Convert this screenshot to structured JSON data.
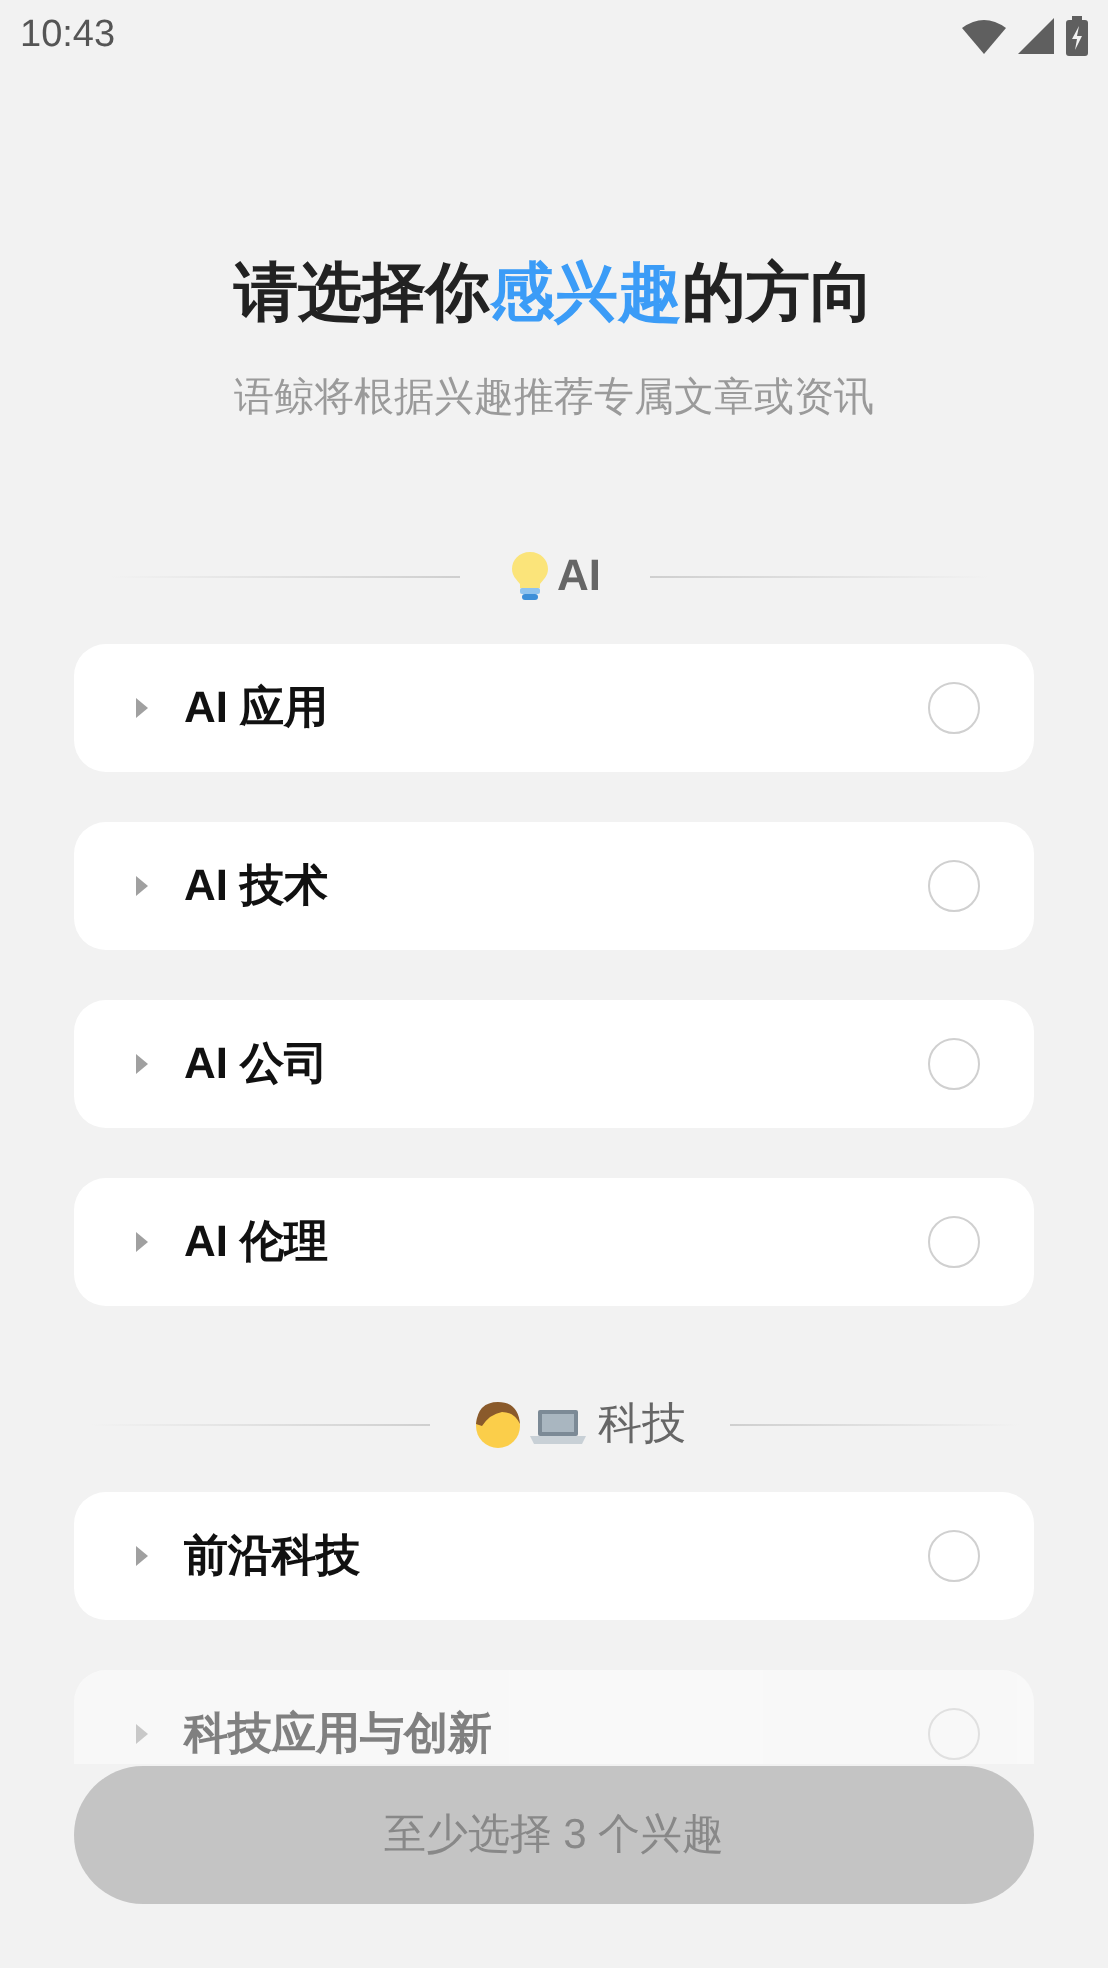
{
  "status_bar": {
    "time": "10:43"
  },
  "title": {
    "before": "请选择你",
    "highlight": "感兴趣",
    "after": "的方向"
  },
  "subtitle": "语鲸将根据兴趣推荐专属文章或资讯",
  "sections": [
    {
      "label": "AI",
      "items": [
        {
          "label": "AI 应用",
          "expanded": false,
          "selected": false
        },
        {
          "label": "AI 技术",
          "expanded": false,
          "selected": false
        },
        {
          "label": "AI 公司",
          "expanded": false,
          "selected": false
        },
        {
          "label": "AI 伦理",
          "expanded": false,
          "selected": false
        }
      ]
    },
    {
      "label": "科技",
      "items": [
        {
          "label": "前沿科技",
          "expanded": false,
          "selected": false
        },
        {
          "label": "科技应用与创新",
          "expanded": false,
          "selected": false
        }
      ]
    }
  ],
  "submit_button": {
    "label": "至少选择 3 个兴趣",
    "disabled": true
  }
}
